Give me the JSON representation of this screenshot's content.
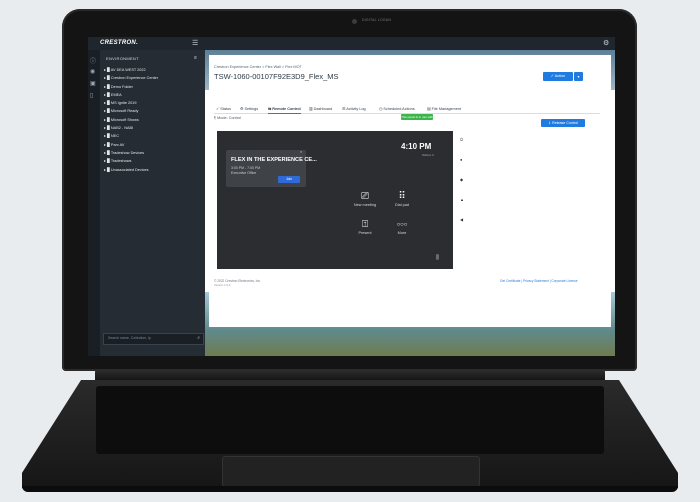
{
  "laptop": {
    "camera_label": "DIGITAL LOGAN"
  },
  "app": {
    "brand": "CRESTRON.",
    "menu_icon": "☰",
    "account_icon": "⚙"
  },
  "sidebar": {
    "heading": "ENVIRONMENT",
    "items": [
      "▸ ▉ AV DEA WEST 2022",
      "▸ ▉ Crestron Experience Center",
      "▸ ▉ Demo Folder",
      "▸ ▉ EMEA",
      "▸ ▉ MS Ignite 2019",
      "▸ ▉ Microsoft Ready",
      "▸ ▉ Microsoft Shows",
      "▸ ▉ NAB2 - NABI",
      "▸ ▉ NEC",
      "▸ ▉ Parx AV",
      "▸ ▉ Tradeshow Devices",
      "▸ ▉ Tradeshows",
      "▸ ▉ Unassociated Devices"
    ],
    "search_placeholder": "Search name, Collection, Ip",
    "search_icon": "⌕"
  },
  "header": {
    "breadcrumb": "Crestron Experience Center  >  Flex Wall  >  Flex MOT",
    "device_title": "TSW-1060-00107F92E3D9_Flex_MS",
    "action_label": "✓  Action",
    "action_caret": "▾"
  },
  "tabs": [
    "✓ Status",
    "⚙ Settings",
    "⇆ Remote Control",
    "▥ Dashboard",
    "☰ Activity Log",
    "◷ Scheduled Actions",
    "▤ File Management"
  ],
  "control": {
    "mode_text": "¶ Mode: Control",
    "badge": "This panel is in use with a client",
    "release_label": "⇩  Release Control"
  },
  "panel": {
    "time": "4:10 PM",
    "room_label": "Webex 2",
    "meeting": {
      "title": "FLEX IN THE EXPERIENCE CE...",
      "time": "3:00 PM - 7:00 PM",
      "location": "Executive Office",
      "join": "Join",
      "close": "×"
    },
    "tiles": [
      {
        "icon": "⎚",
        "label": "New meeting"
      },
      {
        "icon": "⠿",
        "label": "Dial pad"
      },
      {
        "icon": "⍐",
        "label": "Present"
      },
      {
        "icon": "○○○",
        "label": "More"
      }
    ],
    "eq_icon": "⫼",
    "side_icons": [
      "⏻",
      "●",
      "◆",
      "▲",
      "◀"
    ]
  },
  "footer": {
    "copyright": "© 2022 Crestron Electronics, Inc.",
    "version": "Version 1.0.0",
    "links": "Get Certificate | Privacy Statement | Corporate License"
  }
}
